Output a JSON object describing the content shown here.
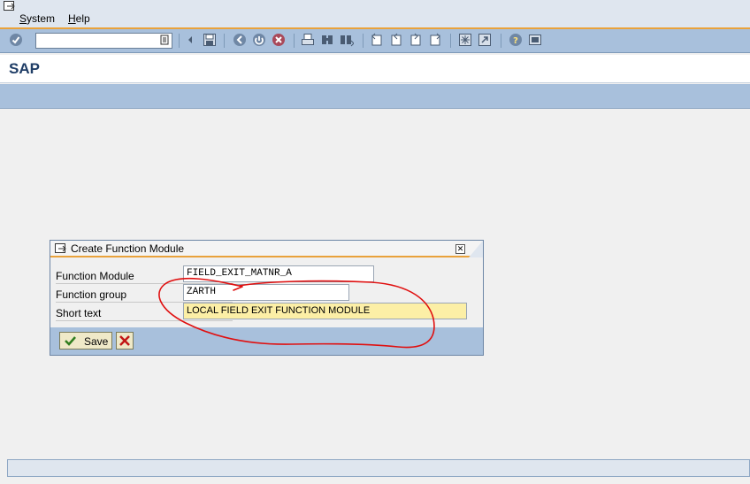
{
  "menubar": {
    "items": [
      {
        "label": "System",
        "mnemonic": "S",
        "rest": "ystem"
      },
      {
        "label": "Help",
        "mnemonic": "H",
        "rest": "elp"
      }
    ]
  },
  "toolbar": {
    "command_field_value": "",
    "icons": [
      "enter-icon",
      "save-icon",
      "back-icon",
      "exit-icon",
      "cancel-icon",
      "print-icon",
      "find-icon",
      "find-next-icon",
      "first-page-icon",
      "previous-page-icon",
      "next-page-icon",
      "last-page-icon",
      "create-session-icon",
      "create-shortcut-icon",
      "help-icon",
      "customize-layout-icon"
    ]
  },
  "title": "SAP",
  "dialog": {
    "title": "Create Function Module",
    "fields": [
      {
        "label": "Function Module",
        "value": "FIELD_EXIT_MATNR_A"
      },
      {
        "label": "Function group",
        "value": "ZARTH"
      },
      {
        "label": "Short text",
        "value": "LOCAL FIELD EXIT FUNCTION MODULE"
      }
    ],
    "save_label": "Save"
  },
  "colors": {
    "accent": "#e9a23b",
    "toolbar": "#a8c0dc",
    "annotation": "#e01010"
  }
}
